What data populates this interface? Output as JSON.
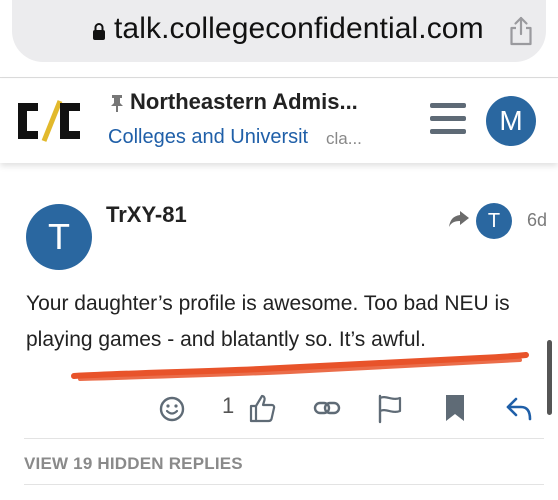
{
  "browser": {
    "url": "talk.collegeconfidential.com",
    "lock_icon": "lock-icon",
    "share_icon": "share-icon"
  },
  "header": {
    "logo": "C/C",
    "pin_icon": "pin-icon",
    "topic_title": "Northeastern Admis...",
    "category": "Colleges and Universit",
    "tag_truncated": "cla...",
    "menu_icon": "hamburger-icon",
    "user_avatar_letter": "M"
  },
  "post": {
    "avatar_letter": "T",
    "username": "TrXY-81",
    "reply_to_avatar_letter": "T",
    "date": "6d",
    "body": "Your daughter’s profile is awesome. Too bad NEU is playing games - and blatantly so. It’s awful.",
    "like_count": "1"
  },
  "actions": {
    "react_icon": "smiley-icon",
    "like_icon": "thumbs-up-icon",
    "link_icon": "link-icon",
    "flag_icon": "flag-icon",
    "bookmark_icon": "bookmark-icon",
    "reply_icon": "reply-icon"
  },
  "hidden_replies_label": "VIEW 19 HIDDEN REPLIES",
  "colors": {
    "accent_blue": "#2a67a0",
    "link_blue": "#1f5fa8",
    "scribble_red": "#e8532a"
  }
}
